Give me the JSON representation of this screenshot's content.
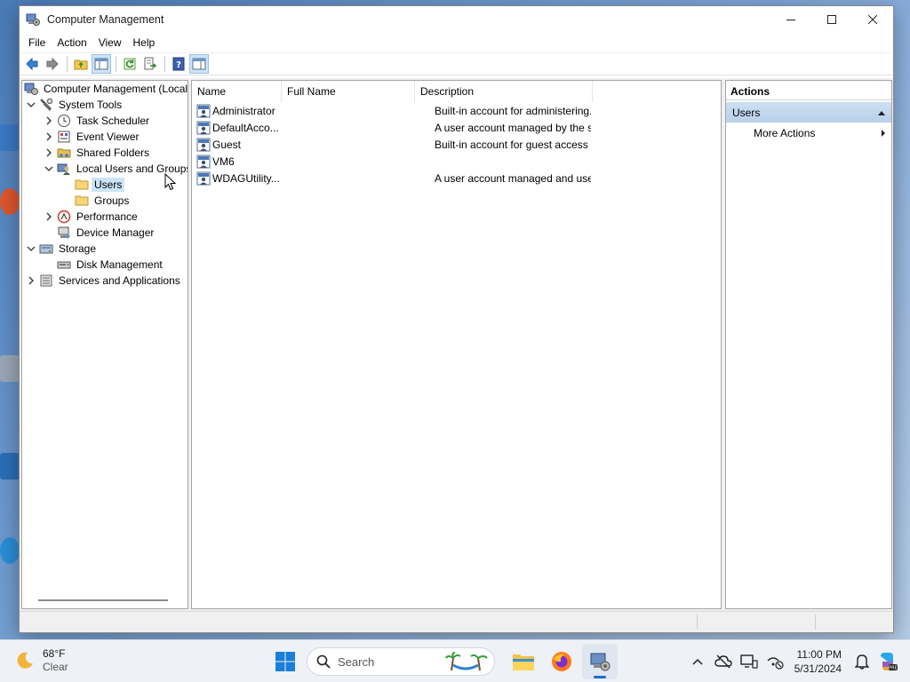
{
  "window": {
    "title": "Computer Management"
  },
  "menu": [
    "File",
    "Action",
    "View",
    "Help"
  ],
  "toolbar": {
    "buttons": [
      "back-icon",
      "forward-icon",
      "up-folder-icon",
      "show-hide-tree-icon",
      "refresh-icon",
      "export-list-icon",
      "help-icon",
      "show-hide-action-pane-icon"
    ]
  },
  "tree": {
    "items": [
      {
        "label": "Computer Management (Local",
        "expander": "",
        "icon": "computer-management-icon"
      },
      {
        "label": "System Tools",
        "expander": "expanded",
        "icon": "tools-icon"
      },
      {
        "label": "Task Scheduler",
        "expander": "collapsed",
        "icon": "clock-icon"
      },
      {
        "label": "Event Viewer",
        "expander": "collapsed",
        "icon": "event-viewer-icon"
      },
      {
        "label": "Shared Folders",
        "expander": "collapsed",
        "icon": "shared-folder-icon"
      },
      {
        "label": "Local Users and Groups",
        "expander": "expanded",
        "icon": "users-groups-icon"
      },
      {
        "label": "Users",
        "expander": "",
        "icon": "folder-icon"
      },
      {
        "label": "Groups",
        "expander": "",
        "icon": "folder-icon"
      },
      {
        "label": "Performance",
        "expander": "collapsed",
        "icon": "performance-icon"
      },
      {
        "label": "Device Manager",
        "expander": "",
        "icon": "device-manager-icon"
      },
      {
        "label": "Storage",
        "expander": "expanded",
        "icon": "storage-icon"
      },
      {
        "label": "Disk Management",
        "expander": "",
        "icon": "disk-icon"
      },
      {
        "label": "Services and Applications",
        "expander": "collapsed",
        "icon": "services-icon"
      }
    ],
    "selected": "Users"
  },
  "list": {
    "columns": [
      "Name",
      "Full Name",
      "Description"
    ],
    "rows": [
      {
        "name": "Administrator",
        "full_name": "",
        "description": "Built-in account for administering..."
      },
      {
        "name": "DefaultAcco...",
        "full_name": "",
        "description": "A user account managed by the s..."
      },
      {
        "name": "Guest",
        "full_name": "",
        "description": "Built-in account for guest access t..."
      },
      {
        "name": "VM6",
        "full_name": "",
        "description": ""
      },
      {
        "name": "WDAGUtility...",
        "full_name": "",
        "description": "A user account managed and use..."
      }
    ]
  },
  "actions": {
    "title": "Actions",
    "group": "Users",
    "items": [
      "More Actions"
    ]
  },
  "taskbar": {
    "weather": {
      "temp": "68°F",
      "condition": "Clear"
    },
    "search_placeholder": "Search",
    "apps": [
      "file-explorer-icon",
      "firefox-icon",
      "computer-management-icon"
    ],
    "clock": {
      "time": "11:00 PM",
      "date": "5/31/2024"
    }
  },
  "colors": {
    "selection": "#cce4f7",
    "actions_header": "#c3d7ee",
    "accent": "#1a6fc9"
  }
}
